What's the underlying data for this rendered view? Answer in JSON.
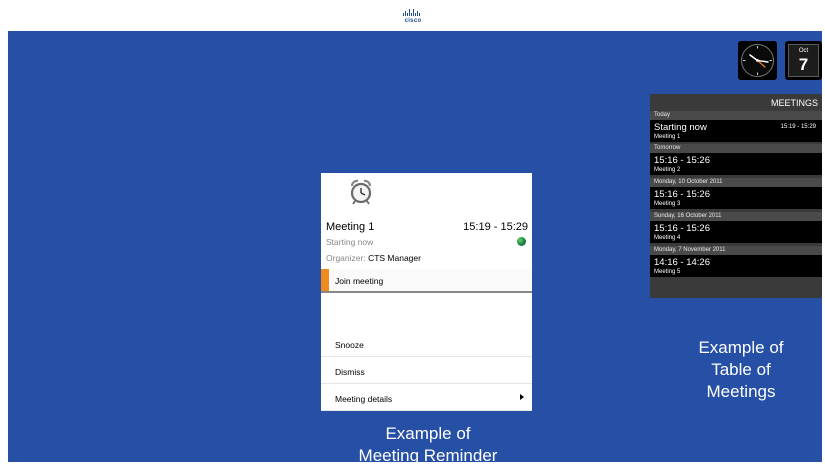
{
  "header": {
    "logo_text": "cisco",
    "logo_icon": "cisco-logo-icon"
  },
  "status": {
    "clock_icon": "analog-clock-icon",
    "date_month": "Oct",
    "date_day": "7"
  },
  "meetings_table": {
    "title": "MEETINGS",
    "groups": [
      {
        "day": "Today",
        "time": "Starting now",
        "name": "Meeting 1",
        "range": "15:19 - 15:29"
      },
      {
        "day": "Tomorrow",
        "time": "15:16 - 15:26",
        "name": "Meeting 2",
        "range": ""
      },
      {
        "day": "Monday, 10 October 2011",
        "time": "15:16 - 15:26",
        "name": "Meeting 3",
        "range": ""
      },
      {
        "day": "Sunday, 16 October 2011",
        "time": "15:16 - 15:26",
        "name": "Meeting 4",
        "range": ""
      },
      {
        "day": "Monday, 7 November 2011",
        "time": "14:16 - 14:26",
        "name": "Meeting 5",
        "range": ""
      }
    ]
  },
  "reminder": {
    "icon": "alarm-clock-icon",
    "title": "Meeting 1",
    "time": "15:19 - 15:29",
    "status": "Starting now",
    "organizer_label": "Organizer:",
    "organizer": "CTS Manager",
    "join_label": "Join meeting",
    "snooze_label": "Snooze",
    "dismiss_label": "Dismiss",
    "details_label": "Meeting details",
    "accent_color": "#f08a1c"
  },
  "captions": {
    "reminder_line1": "Example of",
    "reminder_line2": "Meeting Reminder",
    "table_line1": "Example of",
    "table_line2": "Table of",
    "table_line3": "Meetings"
  },
  "colors": {
    "background": "#264fa6",
    "panel": "#000000"
  }
}
